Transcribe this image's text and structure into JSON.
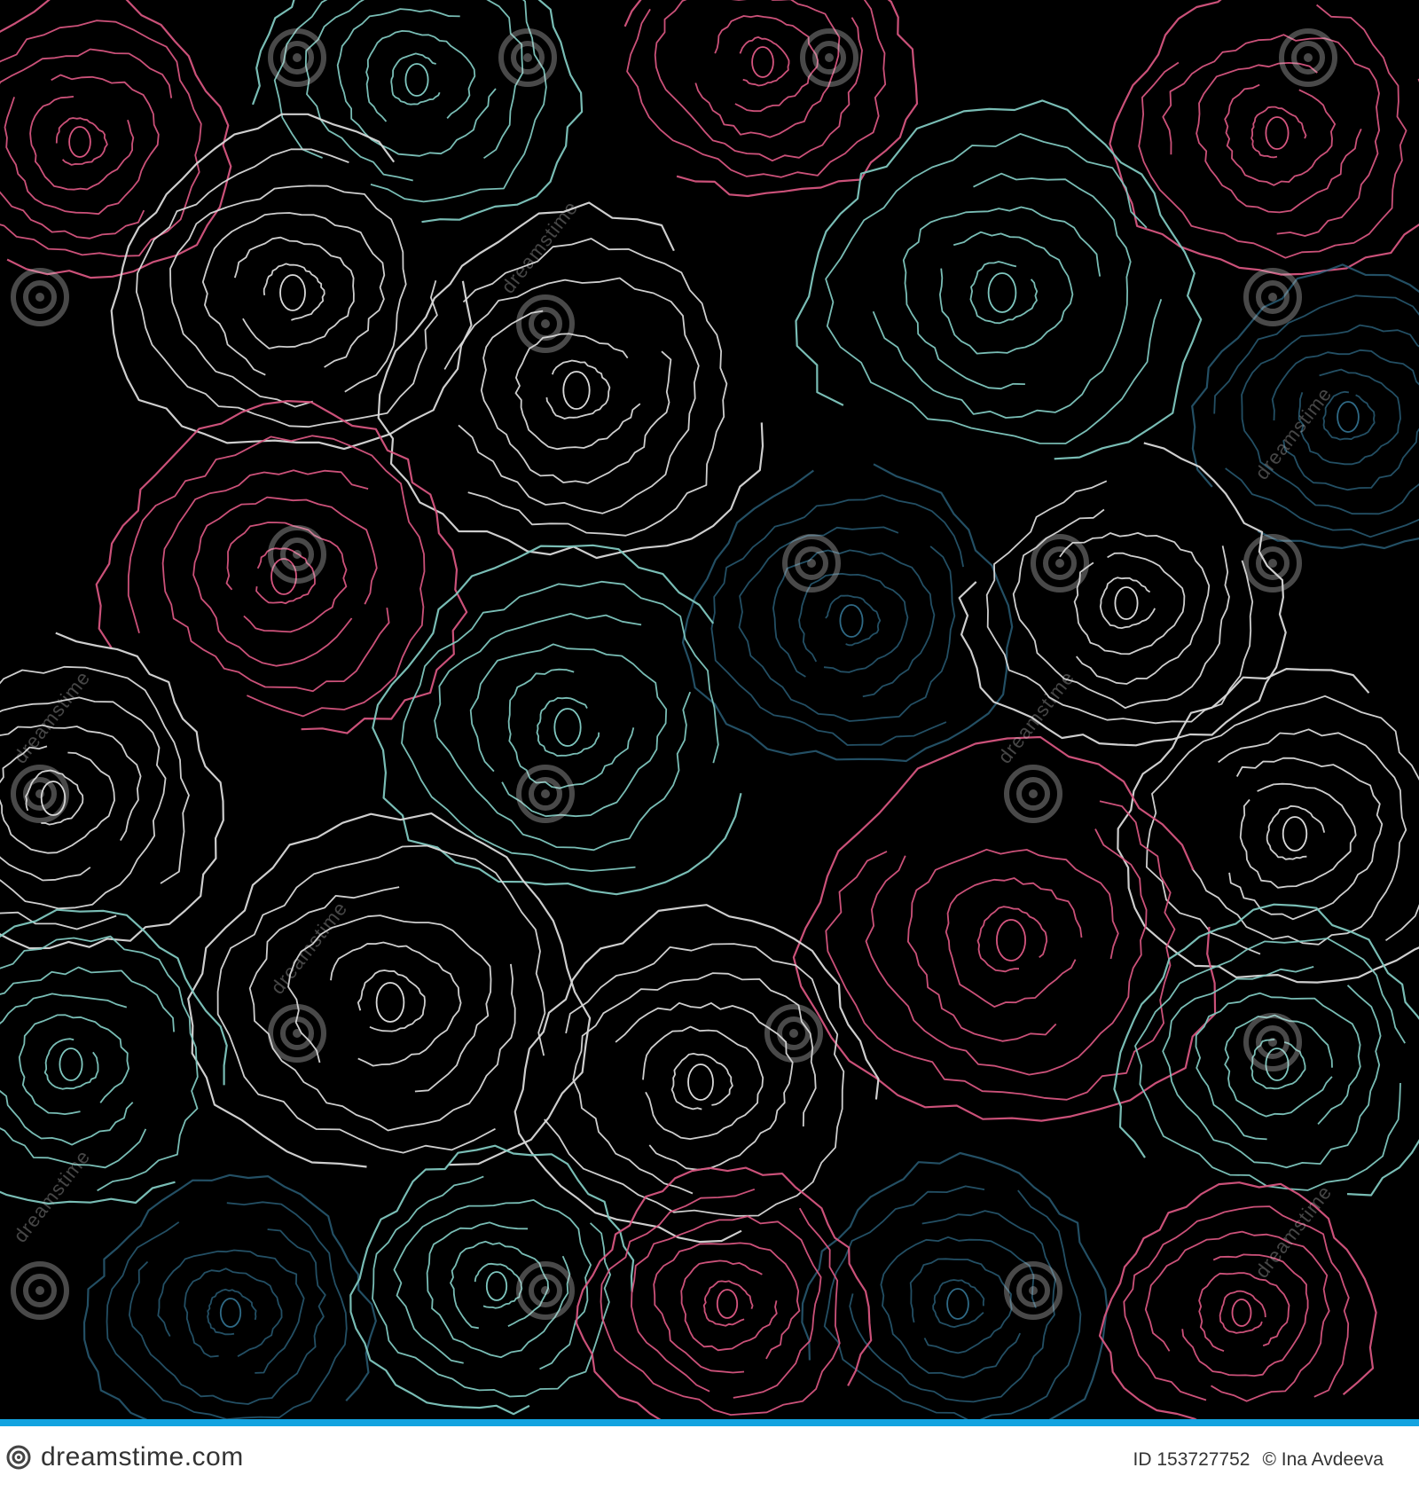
{
  "image": {
    "subject": "seamless pattern of outlined roses",
    "background_color": "#000000",
    "line_colors": [
      "#d6557f",
      "#7fc7bf",
      "#d9d9d9",
      "#2f6a86"
    ]
  },
  "watermark": {
    "text": "dreamstime",
    "icon": "spiral-icon"
  },
  "footer": {
    "accent_color": "#13a3e0",
    "brand_text": "dreamstime.com",
    "brand_icon": "spiral-icon",
    "id_text": "ID 153727752",
    "author_text": "© Ina Avdeeva"
  }
}
